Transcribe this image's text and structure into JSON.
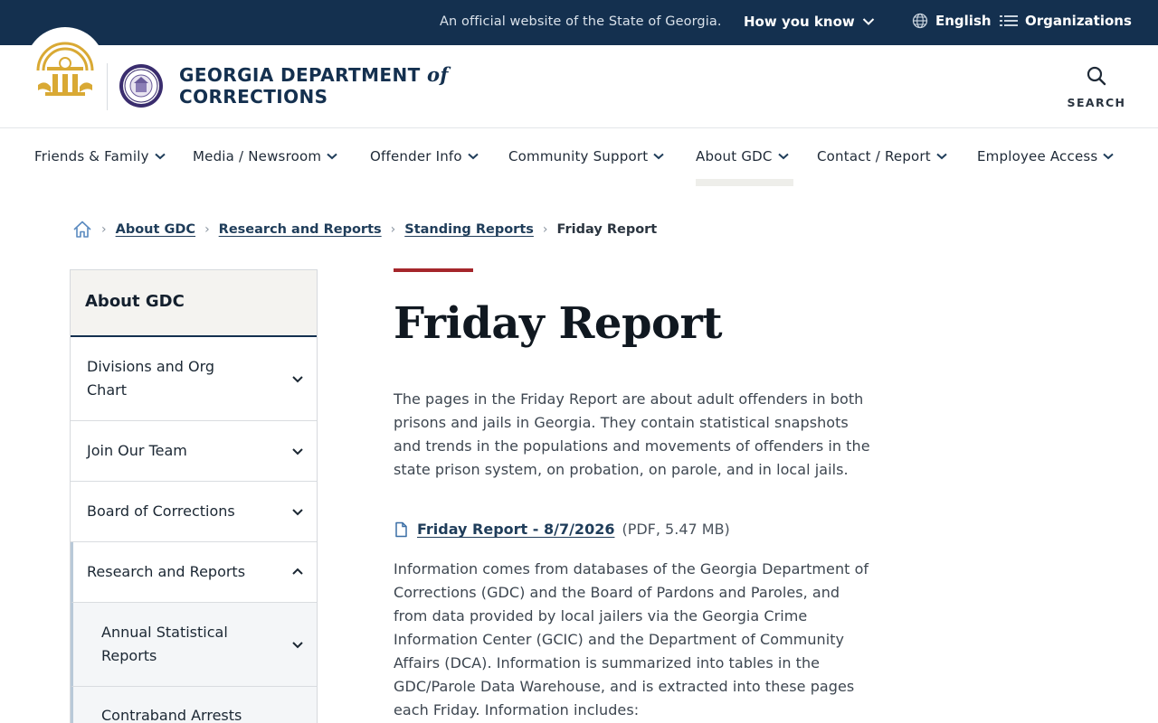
{
  "topbar": {
    "official": "An official website of the State of Georgia.",
    "how_you_know": "How you know",
    "language": "English",
    "organizations": "Organizations"
  },
  "header": {
    "agency_line1": "GEORGIA DEPARTMENT",
    "agency_of": "of",
    "agency_line2": "CORRECTIONS",
    "search_label": "SEARCH"
  },
  "nav": {
    "items": [
      {
        "label": "Friends & Family"
      },
      {
        "label": "Media / Newsroom"
      },
      {
        "label": "Offender Info"
      },
      {
        "label": "Community Support"
      },
      {
        "label": "About GDC"
      },
      {
        "label": "Contact / Report"
      },
      {
        "label": "Employee Access"
      }
    ],
    "active": "About GDC"
  },
  "breadcrumb": {
    "items": [
      "About GDC",
      "Research and Reports",
      "Standing Reports"
    ],
    "current": "Friday Report"
  },
  "sidebar": {
    "heading": "About GDC",
    "items": [
      {
        "label": "Divisions and Org Chart",
        "expanded": false
      },
      {
        "label": "Join Our Team",
        "expanded": false
      },
      {
        "label": "Board of Corrections",
        "expanded": false
      },
      {
        "label": "Research and Reports",
        "expanded": true
      },
      {
        "label": "Annual Statistical Reports",
        "expanded": false
      },
      {
        "label": "Contraband Arrests",
        "expanded": false
      }
    ]
  },
  "content": {
    "title": "Friday Report",
    "intro": "The pages in the Friday Report are about adult offenders in both prisons and jails in Georgia. They contain statistical snapshots and trends in the populations and movements of offenders in the state prison system, on probation, on parole, and in local jails.",
    "file_link": "Friday Report - 8/7/2026",
    "file_meta": "(PDF, 5.47 MB)",
    "info": "Information comes from databases of the Georgia Department of Corrections (GDC) and the Board of Pardons and Paroles, and from data provided by local jailers via the Georgia Crime Information Center (GCIC) and the Department of Community Affairs (DCA). Information is summarized into tables in the GDC/Parole Data Warehouse, and is extracted into these pages each Friday. Information includes:"
  },
  "colors": {
    "navy": "#14304f",
    "accent_red": "#a5262b",
    "link": "#1f3d5a",
    "gold": "#d9a934"
  }
}
